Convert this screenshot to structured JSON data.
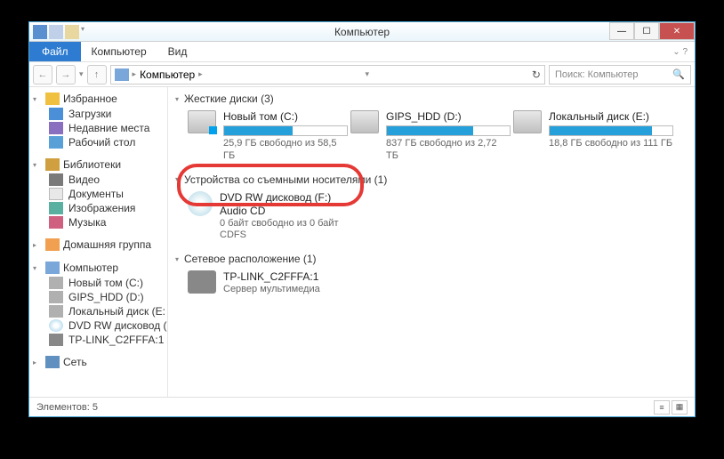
{
  "window": {
    "title": "Компьютер"
  },
  "ribbon": {
    "file": "Файл",
    "tabs": [
      "Компьютер",
      "Вид"
    ]
  },
  "nav": {
    "back": "←",
    "fwd": "→",
    "up": "↑",
    "crumbs": [
      "Компьютер"
    ],
    "search_placeholder": "Поиск: Компьютер"
  },
  "tree": {
    "favorites": {
      "label": "Избранное",
      "items": [
        {
          "label": "Загрузки",
          "icon": "ic-dl"
        },
        {
          "label": "Недавние места",
          "icon": "ic-recent"
        },
        {
          "label": "Рабочий стол",
          "icon": "ic-desk"
        }
      ]
    },
    "libraries": {
      "label": "Библиотеки",
      "items": [
        {
          "label": "Видео",
          "icon": "ic-vid"
        },
        {
          "label": "Документы",
          "icon": "ic-doc"
        },
        {
          "label": "Изображения",
          "icon": "ic-img"
        },
        {
          "label": "Музыка",
          "icon": "ic-mus"
        }
      ]
    },
    "homegroup": {
      "label": "Домашняя группа"
    },
    "computer": {
      "label": "Компьютер",
      "items": [
        {
          "label": "Новый том (C:)",
          "icon": "ic-hdd"
        },
        {
          "label": "GIPS_HDD (D:)",
          "icon": "ic-hdd"
        },
        {
          "label": "Локальный диск (E:",
          "icon": "ic-hdd"
        },
        {
          "label": "DVD RW дисковод (F",
          "icon": "ic-dvd"
        },
        {
          "label": "TP-LINK_C2FFFA:1",
          "icon": "ic-srv"
        }
      ]
    },
    "network": {
      "label": "Сеть"
    }
  },
  "sections": {
    "hdd": {
      "title": "Жесткие диски (3)",
      "drives": [
        {
          "name": "Новый том (C:)",
          "free": "25,9 ГБ свободно из 58,5 ГБ",
          "fill": 56,
          "os": true
        },
        {
          "name": "GIPS_HDD (D:)",
          "free": "837 ГБ свободно из 2,72 ТБ",
          "fill": 70
        },
        {
          "name": "Локальный диск (E:)",
          "free": "18,8 ГБ свободно из 111 ГБ",
          "fill": 83
        }
      ]
    },
    "removable": {
      "title": "Устройства со съемными носителями (1)",
      "drives": [
        {
          "name": "DVD RW дисковод (F:) Audio CD",
          "free": "0 байт свободно из 0 байт",
          "fs": "CDFS"
        }
      ]
    },
    "netloc": {
      "title": "Сетевое расположение (1)",
      "drives": [
        {
          "name": "TP-LINK_C2FFFA:1",
          "sub": "Сервер мультимедиа"
        }
      ]
    }
  },
  "status": {
    "text": "Элементов: 5"
  }
}
